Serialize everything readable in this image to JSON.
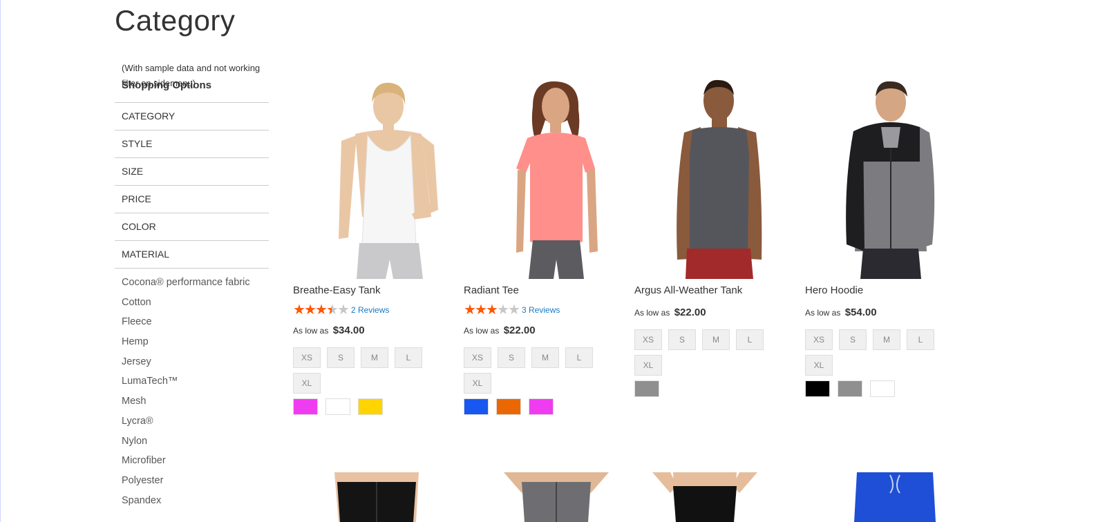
{
  "page": {
    "title": "Category"
  },
  "sidebar": {
    "note": "(With sample data and not working filter on sidemenu)",
    "heading": "Shopping Options",
    "filters": [
      "CATEGORY",
      "STYLE",
      "SIZE",
      "PRICE",
      "COLOR",
      "MATERIAL"
    ],
    "materials": [
      "Cocona® performance fabric",
      "Cotton",
      "Fleece",
      "Hemp",
      "Jersey",
      "LumaTech™",
      "Mesh",
      "Lycra®",
      "Nylon",
      "Microfiber",
      "Polyester",
      "Spandex"
    ]
  },
  "products": [
    {
      "name": "Breathe-Easy Tank",
      "rating": 3.5,
      "reviews": "2 Reviews",
      "price_prefix": "As low as",
      "price": "$34.00",
      "sizes": [
        "XS",
        "S",
        "M",
        "L",
        "XL"
      ],
      "colors": [
        "#f03cf0",
        "#ffffff",
        "#ffd400"
      ]
    },
    {
      "name": "Radiant Tee",
      "rating": 3,
      "reviews": "3 Reviews",
      "price_prefix": "As low as",
      "price": "$22.00",
      "sizes": [
        "XS",
        "S",
        "M",
        "L",
        "XL"
      ],
      "colors": [
        "#1857f0",
        "#eb6703",
        "#f03cf0"
      ]
    },
    {
      "name": "Argus All-Weather Tank",
      "rating": null,
      "reviews": "",
      "price_prefix": "As low as",
      "price": "$22.00",
      "sizes": [
        "XS",
        "S",
        "M",
        "L",
        "XL"
      ],
      "colors": [
        "#8f8f8f"
      ]
    },
    {
      "name": "Hero Hoodie",
      "rating": null,
      "reviews": "",
      "price_prefix": "As low as",
      "price": "$54.00",
      "sizes": [
        "XS",
        "S",
        "M",
        "L",
        "XL"
      ],
      "colors": [
        "#000000",
        "#8f8f8f",
        "#ffffff"
      ]
    }
  ],
  "colors": {
    "star_filled": "#ff5501",
    "star_empty": "#c7c7c7",
    "link": "#1979c3"
  }
}
